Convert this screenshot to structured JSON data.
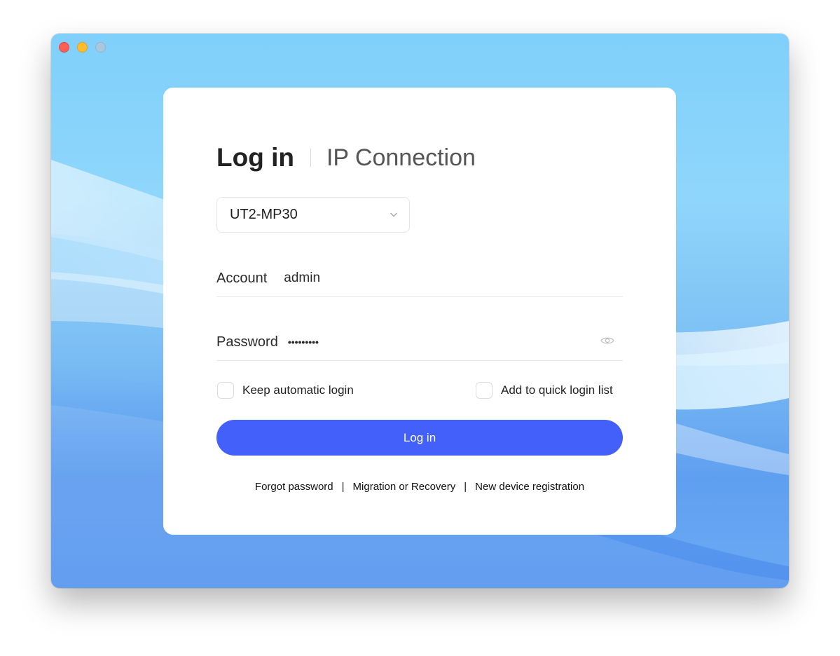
{
  "window": {
    "controls": [
      "close",
      "minimize",
      "maximize"
    ]
  },
  "login": {
    "tabs": {
      "login": "Log in",
      "ip_connection": "IP Connection"
    },
    "device": {
      "selected": "UT2-MP30",
      "icon": "chevron-down-icon"
    },
    "account": {
      "label": "Account",
      "value": "admin"
    },
    "password": {
      "label": "Password",
      "value": "•••••••••",
      "icon": "eye-icon"
    },
    "options": {
      "keep_auto_login": "Keep automatic login",
      "quick_login_list": "Add to quick login list"
    },
    "submit_label": "Log in",
    "links": {
      "forgot": "Forgot password",
      "migration": "Migration or Recovery",
      "register": "New device registration",
      "separator": "|"
    }
  },
  "colors": {
    "primary": "#4360fb",
    "close": "#fe5f57",
    "minimize": "#febc2e",
    "background_top": "#7fd0fb",
    "background_bottom": "#5f9ff0"
  }
}
